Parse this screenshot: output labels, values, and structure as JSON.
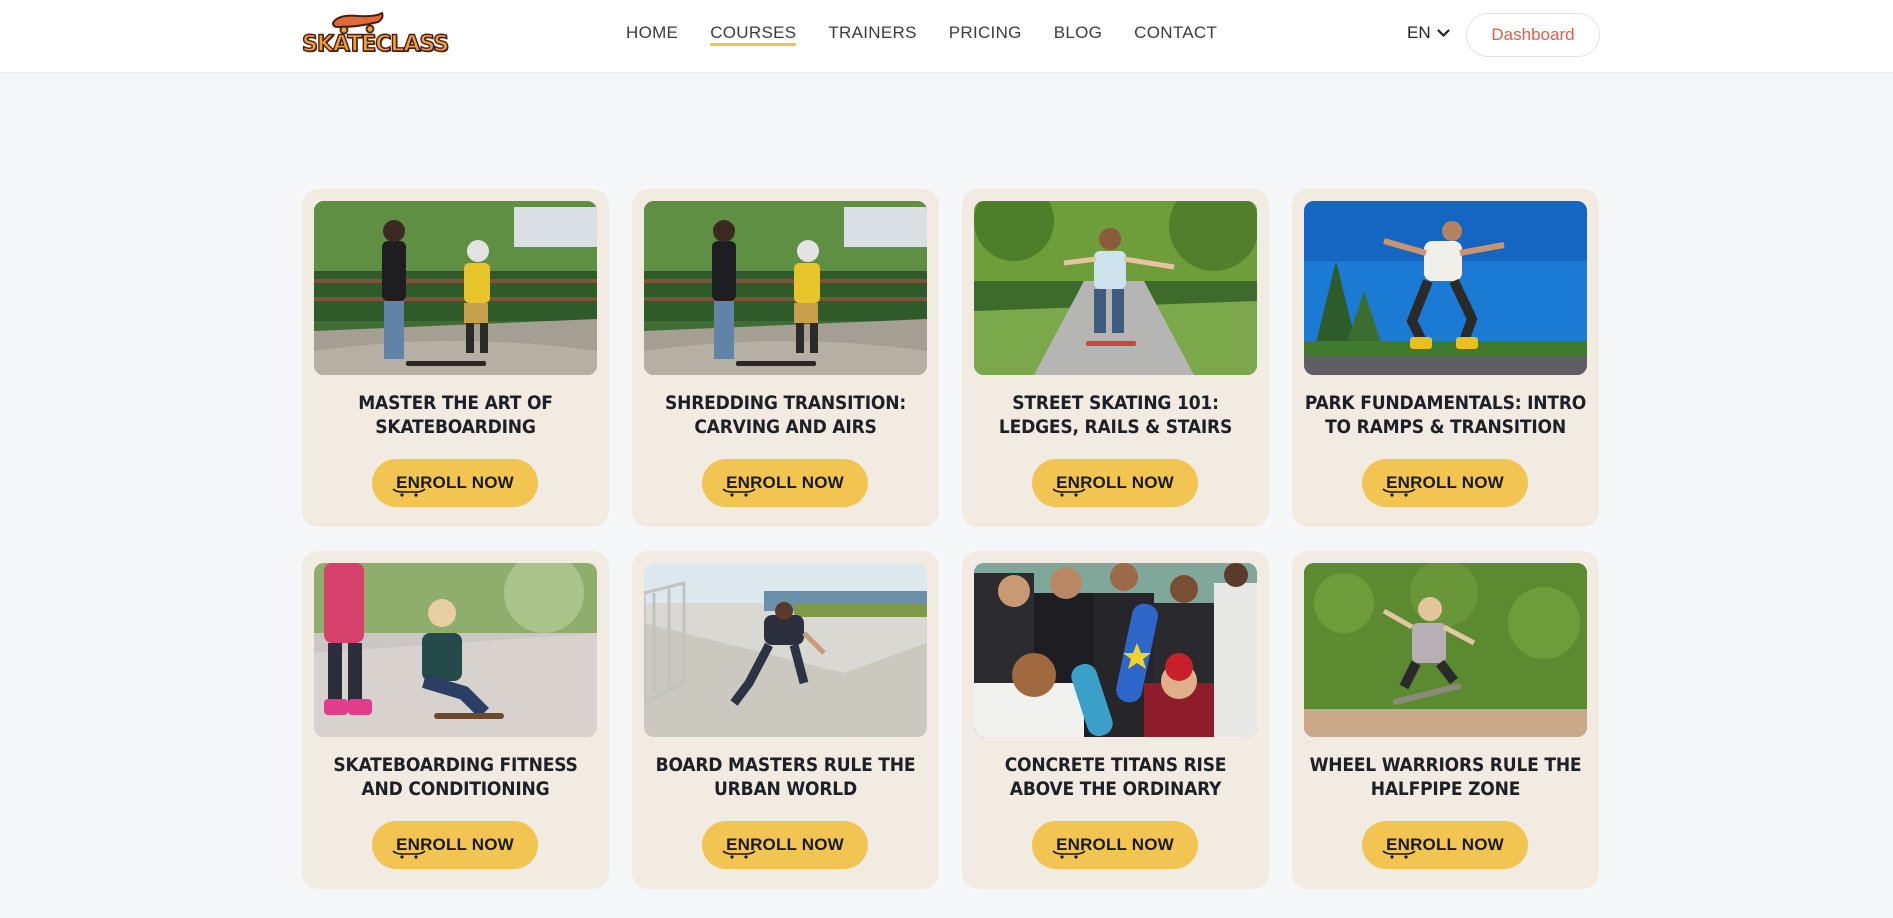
{
  "brand": {
    "logo_text": "SKATECLASS"
  },
  "nav": {
    "items": [
      {
        "label": "HOME",
        "active": false
      },
      {
        "label": "COURSES",
        "active": true
      },
      {
        "label": "TRAINERS",
        "active": false
      },
      {
        "label": "PRICING",
        "active": false
      },
      {
        "label": "BLOG",
        "active": false
      },
      {
        "label": "CONTACT",
        "active": false
      }
    ]
  },
  "header": {
    "language": "EN",
    "dashboard_label": "Dashboard"
  },
  "courses": [
    {
      "title": "MASTER THE ART OF SKATEBOARDING",
      "button": "ENROLL NOW",
      "photo": "instructor-and-kid-skatepark"
    },
    {
      "title": "SHREDDING TRANSITION: CARVING AND AIRS",
      "button": "ENROLL NOW",
      "photo": "instructor-and-kid-skatepark"
    },
    {
      "title": "STREET SKATING 101: LEDGES, RAILS & STAIRS",
      "button": "ENROLL NOW",
      "photo": "boy-skating-park-path"
    },
    {
      "title": "PARK FUNDAMENTALS: INTRO TO RAMPS & TRANSITION",
      "button": "ENROLL NOW",
      "photo": "man-rollerblading-blue-sky"
    },
    {
      "title": "SKATEBOARDING FITNESS AND CONDITIONING",
      "button": "ENROLL NOW",
      "photo": "girls-skating-laughing"
    },
    {
      "title": "BOARD MASTERS RULE THE URBAN WORLD",
      "button": "ENROLL NOW",
      "photo": "skater-on-ramp-rail"
    },
    {
      "title": "CONCRETE TITANS RISE ABOVE THE ORDINARY",
      "button": "ENROLL NOW",
      "photo": "group-of-teen-skaters"
    },
    {
      "title": "WHEEL WARRIORS RULE THE HALFPIPE ZONE",
      "button": "ENROLL NOW",
      "photo": "kid-jumping-skateboard-hedge"
    }
  ],
  "colors": {
    "accent": "#f2c553",
    "card_bg": "#f2ebe2",
    "dashboard_text": "#ee5a4c",
    "page_bg": "#f6f7f8"
  }
}
